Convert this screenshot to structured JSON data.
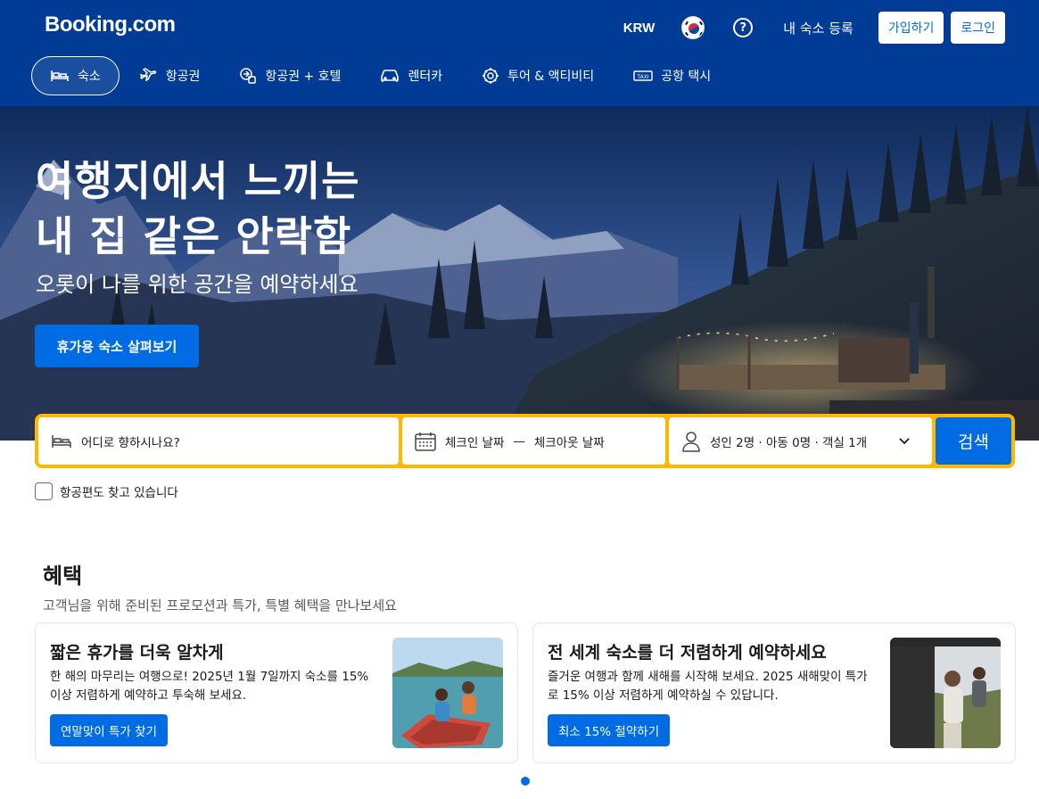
{
  "header": {
    "logo": "Booking.com",
    "currency": "KRW",
    "help": "?",
    "list_property": "내 숙소 등록",
    "register": "가입하기",
    "sign_in": "로그인"
  },
  "nav": [
    {
      "label": "숙소",
      "icon": "bed-icon",
      "active": true
    },
    {
      "label": "항공권",
      "icon": "plane-icon"
    },
    {
      "label": "항공권 + 호텔",
      "icon": "flight-hotel-icon"
    },
    {
      "label": "렌터카",
      "icon": "car-icon"
    },
    {
      "label": "투어 & 액티비티",
      "icon": "attractions-icon"
    },
    {
      "label": "공항 택시",
      "icon": "taxi-icon"
    }
  ],
  "hero": {
    "title_line1": "여행지에서 느끼는",
    "title_line2": "내 집 같은 안락함",
    "subtitle": "오롯이 나를 위한 공간을 예약하세요",
    "cta": "휴가용 숙소 살펴보기"
  },
  "search": {
    "destination_placeholder": "어디로 향하시나요?",
    "checkin": "체크인 날짜",
    "separator": "—",
    "checkout": "체크아웃 날짜",
    "guests": "성인 2명 · 아동 0명 · 객실 1개",
    "button": "검색"
  },
  "flight_checkbox": {
    "label": "항공편도 찾고 있습니다",
    "checked": false
  },
  "offers": {
    "title": "혜택",
    "subtitle": "고객님을 위해 준비된 프로모션과 특가, 특별 혜택을 만나보세요",
    "cards": [
      {
        "title": "짧은 휴가를 더욱 알차게",
        "text": "한 해의 마무리는 여행으로! 2025년 1월 7일까지 숙소를 15% 이상 저렴하게 예약하고 투숙해 보세요.",
        "button": "연말맞이 특가 찾기"
      },
      {
        "title": "전 세계 숙소를 더 저렴하게 예약하세요",
        "text": "즐거운 여행과 함께 새해를 시작해 보세요. 2025 새해맞이 특가로 15% 이상 저렴하게 예약하실 수 있답니다.",
        "button": "최소 15% 절약하기"
      }
    ]
  },
  "colors": {
    "brand_blue": "#003b95",
    "action_blue": "#006ce4",
    "search_border": "#ffb700"
  }
}
